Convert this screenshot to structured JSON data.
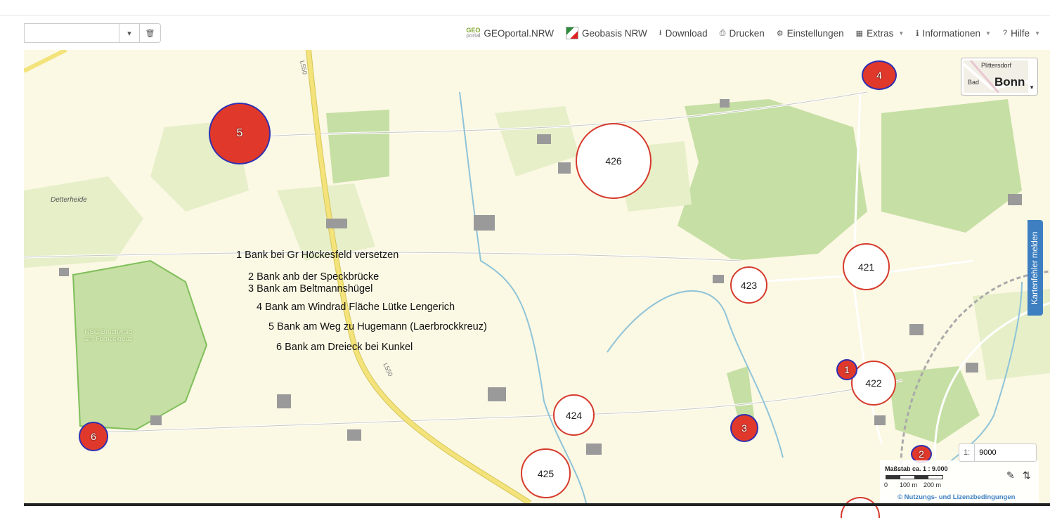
{
  "search": {
    "value": "",
    "dropdown_icon": "chevron-down-icon",
    "clear_icon": "trash-icon"
  },
  "nav": {
    "geoportal_logo_top": "GEO",
    "geoportal_logo_bottom": "portal",
    "geoportal": "GEOportal.NRW",
    "geobasis": "Geobasis NRW",
    "download": "Download",
    "print": "Drucken",
    "settings": "Einstellungen",
    "extras": "Extras",
    "info": "Informationen",
    "help": "Hilfe"
  },
  "clusters": [
    {
      "label": "426",
      "kind": "count"
    },
    {
      "label": "421",
      "kind": "count"
    },
    {
      "label": "423",
      "kind": "count"
    },
    {
      "label": "422",
      "kind": "count"
    },
    {
      "label": "424",
      "kind": "count"
    },
    {
      "label": "425",
      "kind": "count"
    }
  ],
  "markers": [
    {
      "label": "5"
    },
    {
      "label": "4"
    },
    {
      "label": "1"
    },
    {
      "label": "3"
    },
    {
      "label": "6"
    },
    {
      "label": "2"
    }
  ],
  "legend_lines": [
    "1 Bank bei Gr Höckesfeld versetzen",
    "2 Bank anb der Speckbrücke",
    "3 Bank am Beltmannshügel",
    "4 Bank am Windrad Fläche Lütke Lengerich",
    "5 Bank am Weg zu Hugemann (Laerbrockkreuz)",
    "6 Bank am Dreieck bei Kunkel"
  ],
  "places": {
    "detterheide": "Detterheide",
    "nsg_line1": "NSG Bruchwald",
    "nsg_line2": "am Ferneskreuz",
    "road_l550": "L550"
  },
  "overview": {
    "small_top": "Plittersdorf",
    "small_left": "Bad",
    "big": "Bonn"
  },
  "report_tab": "Kartenfehler melden",
  "scale": {
    "prefix": "1:",
    "value": "9000",
    "caption": "Maßstab ca. 1 : 9.000",
    "tick0": "0",
    "tick1": "100 m",
    "tick2": "200 m"
  },
  "license": "© Nutzungs- und Lizenzbedingungen",
  "colors": {
    "accent": "#3d7fc1",
    "cluster_border": "#d63a2c",
    "marker_fill": "#e0392b",
    "marker_border": "#2f2fb0",
    "forest": "#c6dfa4",
    "road_yellow": "#f3e37a"
  }
}
